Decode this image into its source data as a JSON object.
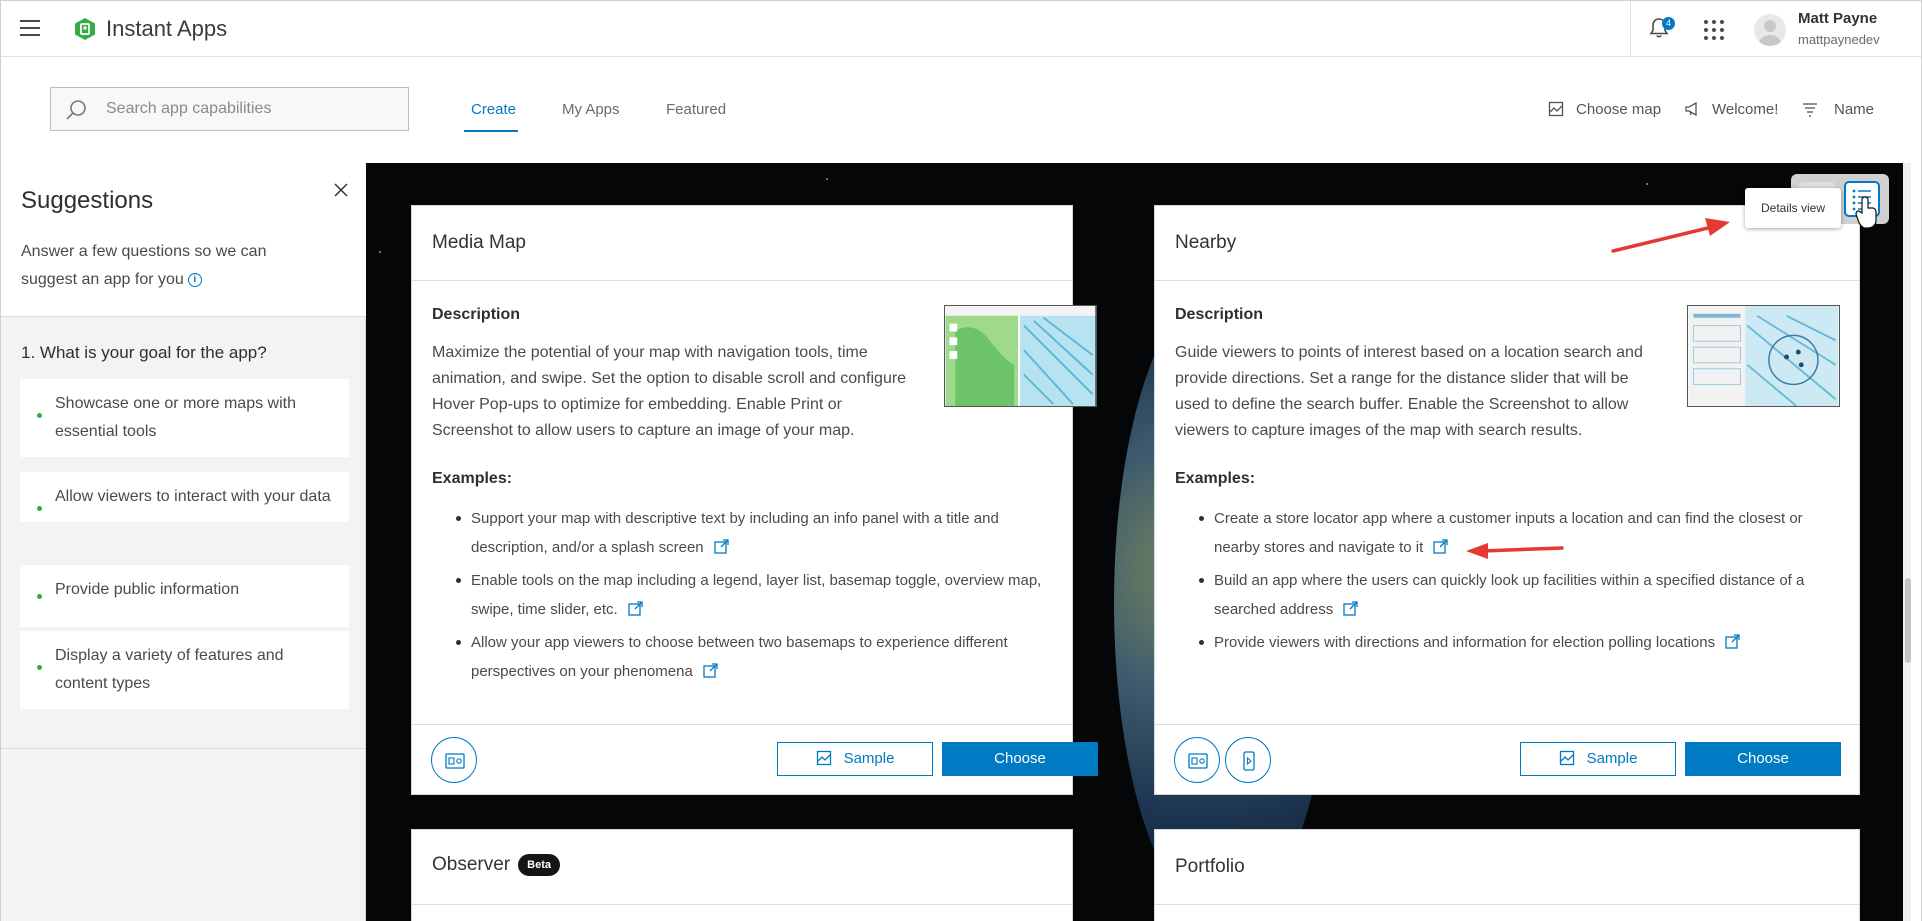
{
  "app": {
    "title": "Instant Apps",
    "brand_color": "#35ac46",
    "accent_color": "#007ac2"
  },
  "header": {
    "notifications_count": "4",
    "user": {
      "name": "Matt Payne",
      "username": "mattpaynedev"
    }
  },
  "search": {
    "placeholder": "Search app capabilities",
    "value": ""
  },
  "tabs": [
    {
      "label": "Create",
      "active": true
    },
    {
      "label": "My Apps",
      "active": false
    },
    {
      "label": "Featured",
      "active": false
    }
  ],
  "actions": {
    "choose_map": "Choose map",
    "welcome": "Welcome!",
    "sort": "Name"
  },
  "suggestions": {
    "title": "Suggestions",
    "description": "Answer a few questions so we can suggest an app for you",
    "question": "1. What is your goal for the app?",
    "options": [
      "Showcase one or more maps with essential tools",
      "Allow viewers to interact with your data",
      "Provide public information",
      "Display a variety of features and content types"
    ]
  },
  "view_toggle": {
    "tooltip": "Details view",
    "selected": "list"
  },
  "cards": [
    {
      "title": "Media Map",
      "description_heading": "Description",
      "description": "Maximize the potential of your map with navigation tools, time animation, and swipe. Set the option to disable scroll and configure Hover Pop-ups to optimize for embedding. Enable Print or Screenshot to allow users to capture an image of your map.",
      "examples_heading": "Examples:",
      "examples": [
        "Support your map with descriptive text by including an info panel with a title and description, and/or a splash screen",
        "Enable tools on the map including a legend, layer list, basemap toggle, overview map, swipe, time slider, etc.",
        "Allow your app viewers to choose between two basemaps to experience different perspectives on your phenomena"
      ],
      "sample_label": "Sample",
      "choose_label": "Choose"
    },
    {
      "title": "Nearby",
      "description_heading": "Description",
      "description": "Guide viewers to points of interest based on a location search and provide directions. Set a range for the distance slider that will be used to define the search buffer. Enable the Screenshot to allow viewers to capture images of the map with search results.",
      "examples_heading": "Examples:",
      "examples": [
        "Create a store locator app where a customer inputs a location and can find the closest or nearby stores and navigate to it",
        "Build an app where the users can quickly look up facilities within a specified distance of a searched address",
        "Provide viewers with directions and information for election polling locations"
      ],
      "sample_label": "Sample",
      "choose_label": "Choose"
    },
    {
      "title": "Observer",
      "badge": "Beta"
    },
    {
      "title": "Portfolio"
    }
  ]
}
